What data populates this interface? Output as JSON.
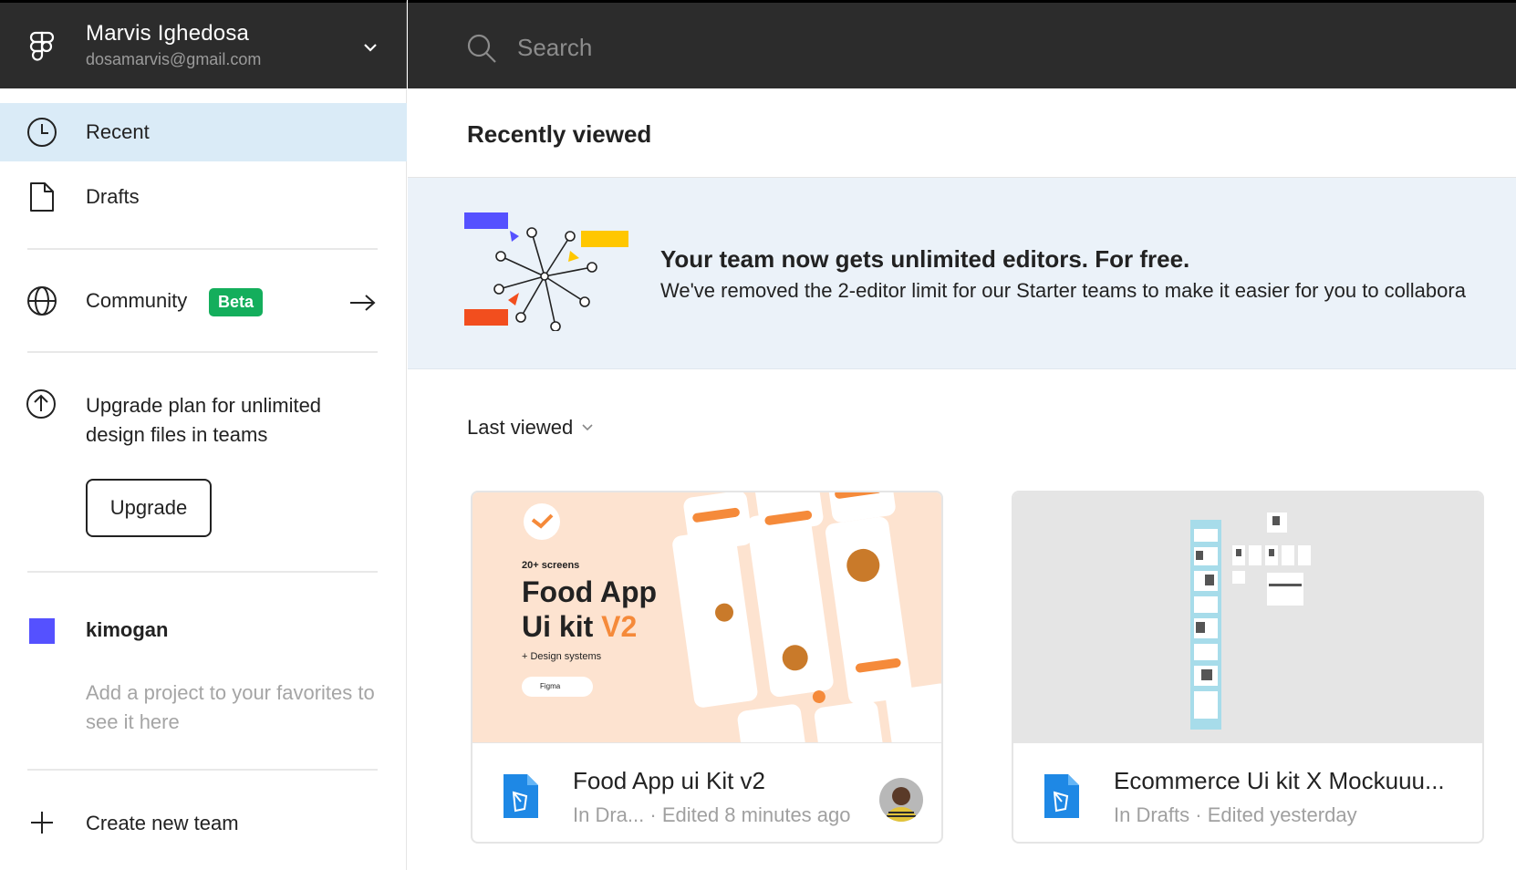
{
  "account": {
    "name": "Marvis Ighedosa",
    "email": "dosamarvis@gmail.com"
  },
  "search": {
    "placeholder": "Search"
  },
  "sidebar": {
    "items": [
      {
        "label": "Recent",
        "icon": "clock-icon",
        "active": true
      },
      {
        "label": "Drafts",
        "icon": "file-icon",
        "active": false
      },
      {
        "label": "Community",
        "icon": "globe-icon",
        "badge": "Beta"
      }
    ],
    "upgrade": {
      "text": "Upgrade plan for unlimited design files in teams",
      "button": "Upgrade"
    },
    "team": {
      "name": "kimogan",
      "color": "#5551ff",
      "favorites_hint": "Add a project to your favorites to see it here"
    },
    "create_team": "Create new team"
  },
  "main": {
    "title": "Recently viewed",
    "banner": {
      "headline": "Your team now gets unlimited editors. For free.",
      "sub": "We've removed the 2-editor limit for our Starter teams to make it easier for you to collabora"
    },
    "sort_label": "Last viewed",
    "files": [
      {
        "name": "Food App ui Kit v2",
        "location": "In Dra...",
        "edited": "· Edited 8 minutes ago",
        "thumb": {
          "screens": "20+ screens",
          "title_line1": "Food App",
          "title_line2": "Ui kit",
          "version": "V2",
          "tagline": "+ Design systems",
          "tool": "Figma"
        }
      },
      {
        "name": "Ecommerce Ui kit X Mockuuu...",
        "location": "In Drafts",
        "edited": "· Edited yesterday"
      }
    ]
  },
  "colors": {
    "topbar": "#2c2c2c",
    "active_nav": "#daebf7",
    "beta_badge": "#14ae5c",
    "banner_bg": "#ebf2f9",
    "file_icon": "#1e88e5",
    "accent_orange": "#f58a3a"
  }
}
